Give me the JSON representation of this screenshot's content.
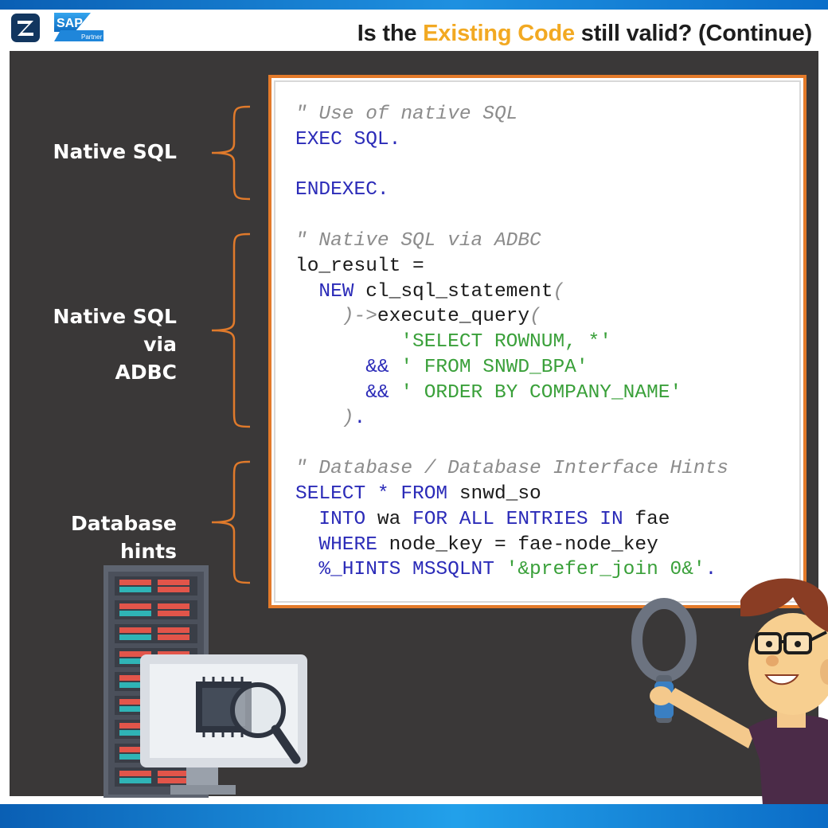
{
  "header": {
    "title_parts": {
      "before": "Is the ",
      "highlight": "Existing Code",
      "after": " still valid? (Continue)"
    },
    "logo_z_letter": "Z",
    "logo_sap_text": "SAP",
    "logo_partner_text": "Partner"
  },
  "colors": {
    "accent": "#f2a922",
    "stage": "#3a3838",
    "frame": "#e37a2a",
    "keyword": "#2b2bb8",
    "string": "#3aa03a",
    "comment": "#8c8c8c",
    "brand_blue": "#0a5fb4"
  },
  "labels": {
    "native_sql": "Native SQL",
    "native_sql_adbc_line1": "Native SQL via",
    "native_sql_adbc_line2": "ADBC",
    "database_hints": "Database hints"
  },
  "code": {
    "lines": [
      [
        {
          "t": "\" Use of native SQL",
          "c": "cm"
        }
      ],
      [
        {
          "t": "EXEC SQL.",
          "c": "kw"
        }
      ],
      [],
      [
        {
          "t": "ENDEXEC.",
          "c": "kw"
        }
      ],
      [],
      [
        {
          "t": "\" Native SQL via ADBC",
          "c": "cm"
        }
      ],
      [
        {
          "t": "lo_result =",
          "c": "pl"
        }
      ],
      [
        {
          "t": "  NEW ",
          "c": "kw"
        },
        {
          "t": "cl_sql_statement",
          "c": "pl"
        },
        {
          "t": "(",
          "c": "cm"
        }
      ],
      [
        {
          "t": "    )->",
          "c": "cm"
        },
        {
          "t": "execute_query",
          "c": "pl"
        },
        {
          "t": "(",
          "c": "cm"
        }
      ],
      [
        {
          "t": "         'SELECT ROWNUM, *'",
          "c": "st"
        }
      ],
      [
        {
          "t": "      && ",
          "c": "kw"
        },
        {
          "t": "' FROM SNWD_BPA'",
          "c": "st"
        }
      ],
      [
        {
          "t": "      && ",
          "c": "kw"
        },
        {
          "t": "' ORDER BY COMPANY_NAME'",
          "c": "st"
        }
      ],
      [
        {
          "t": "    )",
          "c": "cm"
        },
        {
          "t": ".",
          "c": "kw"
        }
      ],
      [],
      [
        {
          "t": "\" Database / Database Interface Hints",
          "c": "cm"
        }
      ],
      [
        {
          "t": "SELECT * FROM ",
          "c": "kw"
        },
        {
          "t": "snwd_so",
          "c": "pl"
        }
      ],
      [
        {
          "t": "  INTO ",
          "c": "kw"
        },
        {
          "t": "wa ",
          "c": "pl"
        },
        {
          "t": "FOR ALL ENTRIES IN ",
          "c": "kw"
        },
        {
          "t": "fae",
          "c": "pl"
        }
      ],
      [
        {
          "t": "  WHERE ",
          "c": "kw"
        },
        {
          "t": "node_key = fae-node_key",
          "c": "pl"
        }
      ],
      [
        {
          "t": "  %_HINTS MSSQLNT ",
          "c": "kw"
        },
        {
          "t": "'&prefer_join 0&'",
          "c": "st"
        },
        {
          "t": ".",
          "c": "kw"
        }
      ]
    ]
  },
  "illustrations": {
    "left": "server-monitor-magnifier-icon",
    "right": "developer-with-magnifier-icon"
  }
}
